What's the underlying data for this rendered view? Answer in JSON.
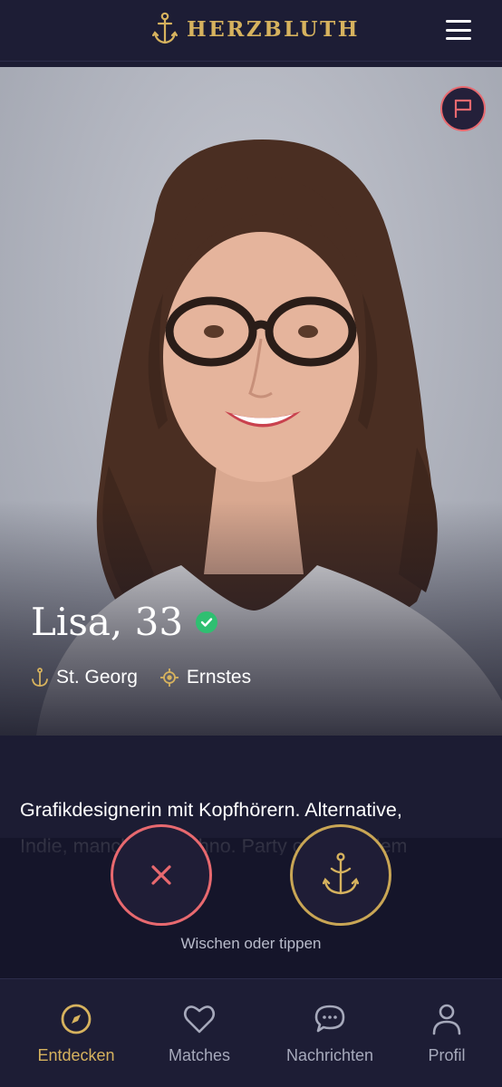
{
  "app": {
    "brand": "HERZBLUTH",
    "brand_icon": "anchor-icon",
    "menu_icon": "hamburger-menu-icon"
  },
  "colors": {
    "background": "#1c1c33",
    "accent_gold": "#d6b25e",
    "accent_red": "#e8696f",
    "verified_green": "#2fbf71"
  },
  "profile": {
    "name_age": "Lisa, 33",
    "verified": true,
    "district": "St. Georg",
    "intention": "Ernstes",
    "report_icon": "flag-icon",
    "bio_line1": "Grafikdesignerin mit Kopfhörern. Alternative,",
    "bio_line2": "Indie, manchmal Techno. Party oder auf dem"
  },
  "actions": {
    "pass_icon": "close-icon",
    "like_icon": "anchor-icon",
    "hint": "Wischen oder tippen"
  },
  "nav": {
    "items": [
      {
        "label": "Entdecken",
        "icon": "compass-icon",
        "active": true
      },
      {
        "label": "Matches",
        "icon": "heart-icon",
        "active": false
      },
      {
        "label": "Nachrichten",
        "icon": "chat-bubble-icon",
        "active": false
      },
      {
        "label": "Profil",
        "icon": "user-icon",
        "active": false
      }
    ]
  }
}
